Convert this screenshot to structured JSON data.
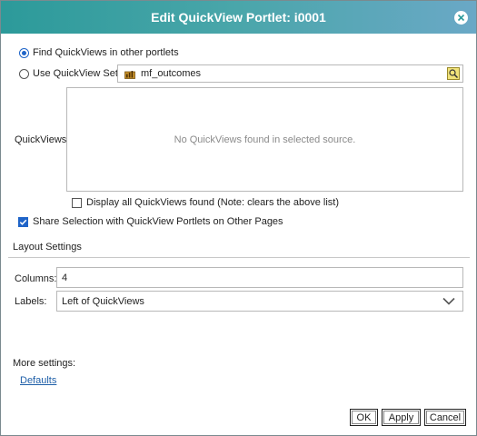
{
  "dialog": {
    "title": "Edit QuickView Portlet: i0001"
  },
  "source": {
    "find_label": "Find QuickViews in other portlets",
    "find_selected": true,
    "use_set_label": "Use QuickView Set:",
    "use_set_selected": false,
    "set_value": "mf_outcomes"
  },
  "quickviews": {
    "label": "QuickViews:",
    "empty_message": "No QuickViews found in selected source."
  },
  "options": {
    "display_all_label": "Display all QuickViews found (Note: clears the above list)",
    "display_all_checked": false,
    "share_label": "Share Selection with QuickView Portlets on Other Pages",
    "share_checked": true
  },
  "layout": {
    "heading": "Layout Settings",
    "columns_label": "Columns:",
    "columns_value": "4",
    "labels_label": "Labels:",
    "labels_value": "Left of QuickViews"
  },
  "more": {
    "heading": "More settings:",
    "defaults_link": "Defaults"
  },
  "buttons": {
    "ok": "OK",
    "apply": "Apply",
    "cancel": "Cancel"
  },
  "colors": {
    "title_gradient_start": "#2c9a9a",
    "title_gradient_end": "#6aa8c6",
    "accent_blue": "#1f64c8",
    "link_blue": "#1f5fa8"
  }
}
